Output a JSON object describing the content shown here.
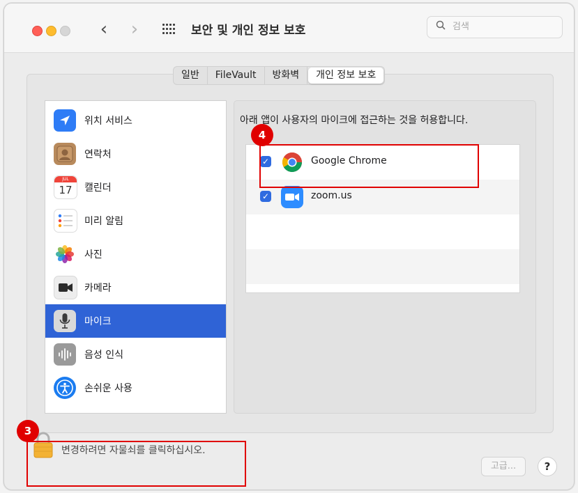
{
  "window": {
    "title": "보안 및 개인 정보 보호",
    "search_placeholder": "검색"
  },
  "tabs": [
    {
      "label": "일반",
      "active": false
    },
    {
      "label": "FileVault",
      "active": false
    },
    {
      "label": "방화벽",
      "active": false
    },
    {
      "label": "개인 정보 보호",
      "active": true
    }
  ],
  "sidebar": {
    "selected": "마이크",
    "items": [
      {
        "label": "위치 서비스",
        "icon": "location-arrow-icon"
      },
      {
        "label": "연락처",
        "icon": "contacts-icon"
      },
      {
        "label": "캘린더",
        "icon": "calendar-icon",
        "icon_month": "JUL",
        "icon_day": "17"
      },
      {
        "label": "미리 알림",
        "icon": "reminders-icon"
      },
      {
        "label": "사진",
        "icon": "photos-icon"
      },
      {
        "label": "카메라",
        "icon": "camera-icon"
      },
      {
        "label": "마이크",
        "icon": "microphone-icon"
      },
      {
        "label": "음성 인식",
        "icon": "speech-recognition-icon"
      },
      {
        "label": "손쉬운 사용",
        "icon": "accessibility-icon"
      }
    ]
  },
  "main": {
    "description": "아래 앱이 사용자의 마이크에 접근하는 것을 허용합니다.",
    "apps": [
      {
        "name": "Google Chrome",
        "checked": true,
        "icon": "chrome-icon"
      },
      {
        "name": "zoom.us",
        "checked": true,
        "icon": "zoom-icon"
      }
    ]
  },
  "footer": {
    "lock_text": "변경하려면 자물쇠를 클릭하십시오.",
    "advanced_label": "고급...",
    "help_label": "?"
  },
  "annotations": [
    {
      "label": "3",
      "target": "lock-area"
    },
    {
      "label": "4",
      "target": "google-chrome-row"
    }
  ],
  "colors": {
    "selection_blue": "#2f63d6",
    "checkbox_blue": "#2f6be0",
    "annotation_red": "#e00000"
  }
}
